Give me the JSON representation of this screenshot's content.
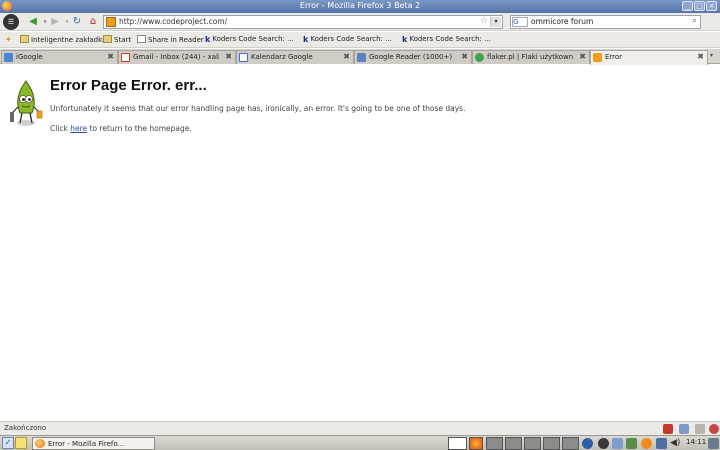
{
  "window": {
    "title": "Error - Mozilla Firefox 3 Beta 2"
  },
  "nav": {
    "url": "http://www.codeproject.com/",
    "search_engine": "G",
    "search_query": "ommicore forum"
  },
  "bookmarks": [
    {
      "label": "Inteligentne zakładki",
      "icon": "folder-icon"
    },
    {
      "label": "Start",
      "icon": "folder-icon"
    },
    {
      "label": "Share in Reader",
      "icon": "page-icon"
    },
    {
      "label": "Koders Code Search: ...",
      "icon": "koders-icon"
    },
    {
      "label": "Koders Code Search: ...",
      "icon": "koders-icon"
    },
    {
      "label": "Koders Code Search: ...",
      "icon": "koders-icon"
    }
  ],
  "tabs": [
    {
      "label": "iGoogle",
      "color": "#4a86d8"
    },
    {
      "label": "Gmail - Inbox (244) - xalld...",
      "color": "#d93b2b"
    },
    {
      "label": "Kalendarz Google",
      "color": "#3b6ecf"
    },
    {
      "label": "Google Reader (1000+)",
      "color": "#5a7fc2"
    },
    {
      "label": "flaker.pl | Flaki użytkowni...",
      "color": "#3fa34d"
    },
    {
      "label": "Error",
      "color": "#f09b1b"
    }
  ],
  "content": {
    "heading": "Error Page Error. err...",
    "message": "Unfortunately it seems that our error handling page has, ironically, an error. It's going to be one of those days.",
    "click_prefix": "Click",
    "click_link": "here",
    "click_suffix": "to return to the homepage."
  },
  "status": {
    "text": "Zakończono"
  },
  "taskbar": {
    "task_label": "Error - Mozilla Firefo...",
    "clock": "14:11"
  },
  "colors": {
    "titlebar": "#6a88bb",
    "accent": "#f09b1b",
    "link": "#2b4fa8"
  }
}
